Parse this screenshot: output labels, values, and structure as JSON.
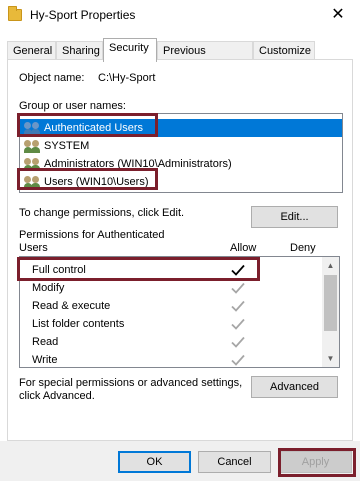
{
  "window": {
    "title": "Hy-Sport Properties",
    "close_glyph": "✕"
  },
  "tabs": [
    {
      "label": "General"
    },
    {
      "label": "Sharing"
    },
    {
      "label": "Security"
    },
    {
      "label": "Previous Versions"
    },
    {
      "label": "Customize"
    }
  ],
  "object": {
    "label": "Object name:",
    "value": "C:\\Hy-Sport"
  },
  "groups": {
    "label": "Group or user names:",
    "items": [
      {
        "label": "Authenticated Users",
        "selected": true
      },
      {
        "label": "SYSTEM",
        "selected": false
      },
      {
        "label": "Administrators (WIN10\\Administrators)",
        "selected": false
      },
      {
        "label": "Users (WIN10\\Users)",
        "selected": false
      }
    ]
  },
  "change_perm": {
    "text": "To change permissions, click Edit.",
    "button": "Edit..."
  },
  "permissions": {
    "heading": "Permissions for Authenticated Users",
    "allow_header": "Allow",
    "deny_header": "Deny",
    "check_glyph": "✓",
    "scroll_up": "▲",
    "scroll_down": "▼",
    "rows": [
      {
        "name": "Full control",
        "allow": true,
        "inherited": false
      },
      {
        "name": "Modify",
        "allow": true,
        "inherited": true
      },
      {
        "name": "Read & execute",
        "allow": true,
        "inherited": true
      },
      {
        "name": "List folder contents",
        "allow": true,
        "inherited": true
      },
      {
        "name": "Read",
        "allow": true,
        "inherited": true
      },
      {
        "name": "Write",
        "allow": true,
        "inherited": true
      }
    ]
  },
  "advanced": {
    "text_line1": "For special permissions or advanced settings,",
    "text_line2": "click Advanced.",
    "button": "Advanced"
  },
  "dialog_buttons": {
    "ok": "OK",
    "cancel": "Cancel",
    "apply": "Apply"
  },
  "colors": {
    "selection": "#0078d7",
    "annotation": "#7b1f2c",
    "check_active": "#000000",
    "check_inherited": "#a6a6a6"
  }
}
